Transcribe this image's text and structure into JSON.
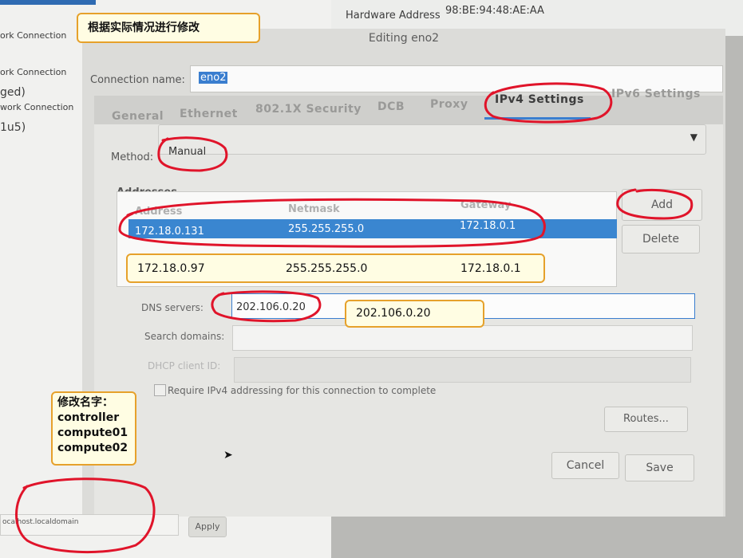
{
  "background_window": {
    "sidebar_items": [
      "ork Connection",
      "ork Connection",
      "ged)",
      "work Connection",
      "1u5)"
    ],
    "hardware_address_label": "Hardware Address",
    "hardware_address_value": "98:BE:94:48:AE:AA",
    "hostname_value": "ocalhost.localdomain",
    "apply_label": "Apply"
  },
  "dialog": {
    "title": "Editing eno2",
    "connection_name_label": "Connection name:",
    "connection_name_value": "eno2",
    "tabs": [
      "General",
      "Ethernet",
      "802.1X Security",
      "DCB",
      "Proxy",
      "IPv4 Settings",
      "IPv6 Settings"
    ],
    "active_tab": "IPv4 Settings",
    "method_label": "Method:",
    "method_value": "Manual",
    "addresses_label": "Addresses",
    "addresses_columns": [
      "Address",
      "Netmask",
      "Gateway"
    ],
    "addresses_rows": [
      {
        "address": "172.18.0.131",
        "netmask": "255.255.255.0",
        "gateway": "172.18.0.1"
      }
    ],
    "add_label": "Add",
    "delete_label": "Delete",
    "dns_label": "DNS servers:",
    "dns_value": "202.106.0.20",
    "search_domains_label": "Search domains:",
    "dhcp_client_id_label": "DHCP client ID:",
    "require_ipv4_label": "Require IPv4 addressing for this connection to complete",
    "routes_label": "Routes...",
    "cancel_label": "Cancel",
    "save_label": "Save"
  },
  "annotations": {
    "top_note": "根据实际情况进行修改",
    "address_note": {
      "address": "172.18.0.97",
      "netmask": "255.255.255.0",
      "gateway": "172.18.0.1"
    },
    "dns_note": "202.106.0.20",
    "rename_note_title": "修改名字：",
    "rename_note_names": [
      "controller",
      "compute01",
      "compute02"
    ]
  },
  "colors": {
    "selection_blue": "#3a86d0",
    "annotation_red": "#e0142a",
    "note_fill": "#fffde3",
    "note_border": "#e6a12b"
  }
}
